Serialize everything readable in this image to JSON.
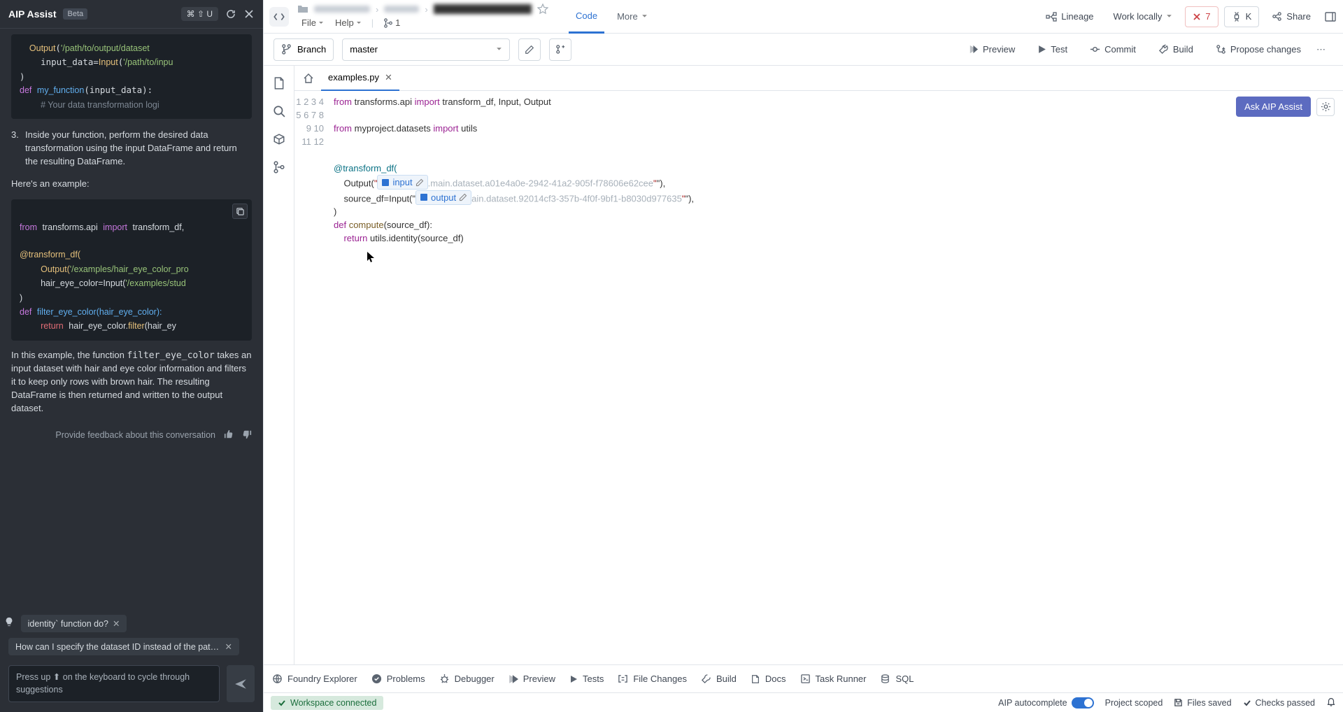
{
  "aip": {
    "title": "AIP Assist",
    "badge": "Beta",
    "kbd": "⌘ ⇧ U",
    "code1": "    Output('/path/to/output/dataset\n    input_data=Input('/path/to/inpu\n)\ndef my_function(input_data):\n    # Your data transformation logi",
    "step3_num": "3.",
    "step3": "Inside your function, perform the desired data transformation using the input DataFrame and return the resulting DataFrame.",
    "example_intro": "Here's an example:",
    "code2_l1a": "from",
    "code2_l1b": "transforms.api",
    "code2_l1c": "import",
    "code2_l1d": "transform_df,",
    "code2_l3": "@transform_df(",
    "code2_l4a": "Output(",
    "code2_l4b": "'/examples/hair_eye_color_pro",
    "code2_l5a": "hair_eye_color=Input(",
    "code2_l5b": "'/examples/stud",
    "code2_l6": ")",
    "code2_l7a": "def",
    "code2_l7b": "filter_eye_color(hair_eye_color):",
    "code2_l8a": "return",
    "code2_l8b": "hair_eye_color.",
    "code2_l8c": "filter",
    "code2_l8d": "(hair_ey",
    "explain_a": "In this example, the function ",
    "explain_code": "filter_eye_color",
    "explain_b": " takes an input dataset with hair and eye color information and filters it to keep only rows with brown hair. The resulting DataFrame is then returned and written to the output dataset.",
    "feedback_label": "Provide feedback about this conversation",
    "chip1": "identity` function do?",
    "chip2": "How can I specify the dataset ID instead of the path whe…",
    "input_placeholder": "Press up ⬆ on the keyboard to cycle through suggestions"
  },
  "top": {
    "file_menu": "File",
    "help_menu": "Help",
    "vc_count": "1",
    "tab_code": "Code",
    "tab_more": "More",
    "lineage": "Lineage",
    "work_locally": "Work locally",
    "err_count": "7",
    "cmd_k": "K",
    "share": "Share"
  },
  "branch": {
    "label": "Branch",
    "name": "master",
    "preview": "Preview",
    "test": "Test",
    "commit": "Commit",
    "build": "Build",
    "propose": "Propose changes"
  },
  "tabs": {
    "file": "examples.py"
  },
  "ask": "Ask AIP Assist",
  "code": {
    "lines": [
      "1",
      "2",
      "3",
      "4",
      "5",
      "6",
      "7",
      "8",
      "9",
      "10",
      "11",
      "12"
    ],
    "l1a": "from",
    "l1b": "transforms.api",
    "l1c": "import",
    "l1d": "transform_df, Input, Output",
    "l3a": "from",
    "l3b": "myproject.datasets",
    "l3c": "import",
    "l3d": "utils",
    "l6": "@transform_df(",
    "l7a": "Output(\"",
    "l7chip": "input",
    "l7b": ".main.dataset.a01e4a0e-2942-41a2-905f-f78606e62cee",
    "l7c": "\"),",
    "l8a": "source_df=Input(\"",
    "l8chip": "output",
    "l8b": "ain.dataset.92014cf3-357b-4f0f-9bf1-b8030d977635",
    "l8c": "\"),",
    "l9": ")",
    "l10a": "def",
    "l10b": "compute(source_df):",
    "l11a": "return",
    "l11b": "utils.identity(source_df)"
  },
  "bottom": {
    "foundry": "Foundry Explorer",
    "problems": "Problems",
    "debugger": "Debugger",
    "preview": "Preview",
    "tests": "Tests",
    "filechanges": "File Changes",
    "build": "Build",
    "docs": "Docs",
    "taskrunner": "Task Runner",
    "sql": "SQL"
  },
  "status": {
    "ws": "Workspace connected",
    "auto": "AIP autocomplete",
    "scoped": "Project scoped",
    "saved": "Files saved",
    "checks": "Checks passed"
  }
}
